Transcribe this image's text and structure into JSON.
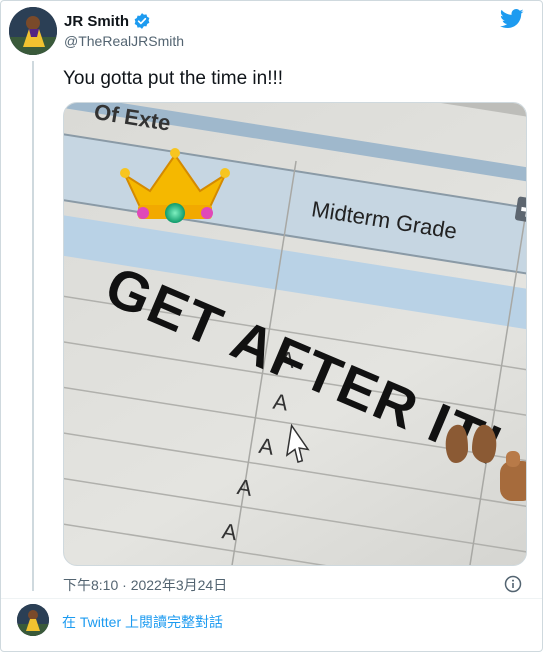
{
  "author": {
    "name": "JR Smith",
    "handle": "@TheRealJRSmith",
    "verified": true
  },
  "tweet": {
    "text": "You gotta put the time in!!!",
    "timestamp": "下午8:10 · 2022年3月24日"
  },
  "media": {
    "sheet_headers": [
      "Of Exte",
      "Midterm Grade",
      "F"
    ],
    "grades": [
      "A",
      "A",
      "A",
      "A",
      "A"
    ],
    "overlay_text": "GET AFTER IT!",
    "emoji": [
      "crown",
      "raised-hands",
      "fist"
    ]
  },
  "footer": {
    "read_more": "在 Twitter 上閱讀完整對話"
  },
  "colors": {
    "link": "#1d9bf0",
    "secondary_text": "#536471",
    "border": "#cfd9de"
  },
  "icons": [
    "twitter-bird-icon",
    "verified-badge-icon",
    "info-icon"
  ]
}
